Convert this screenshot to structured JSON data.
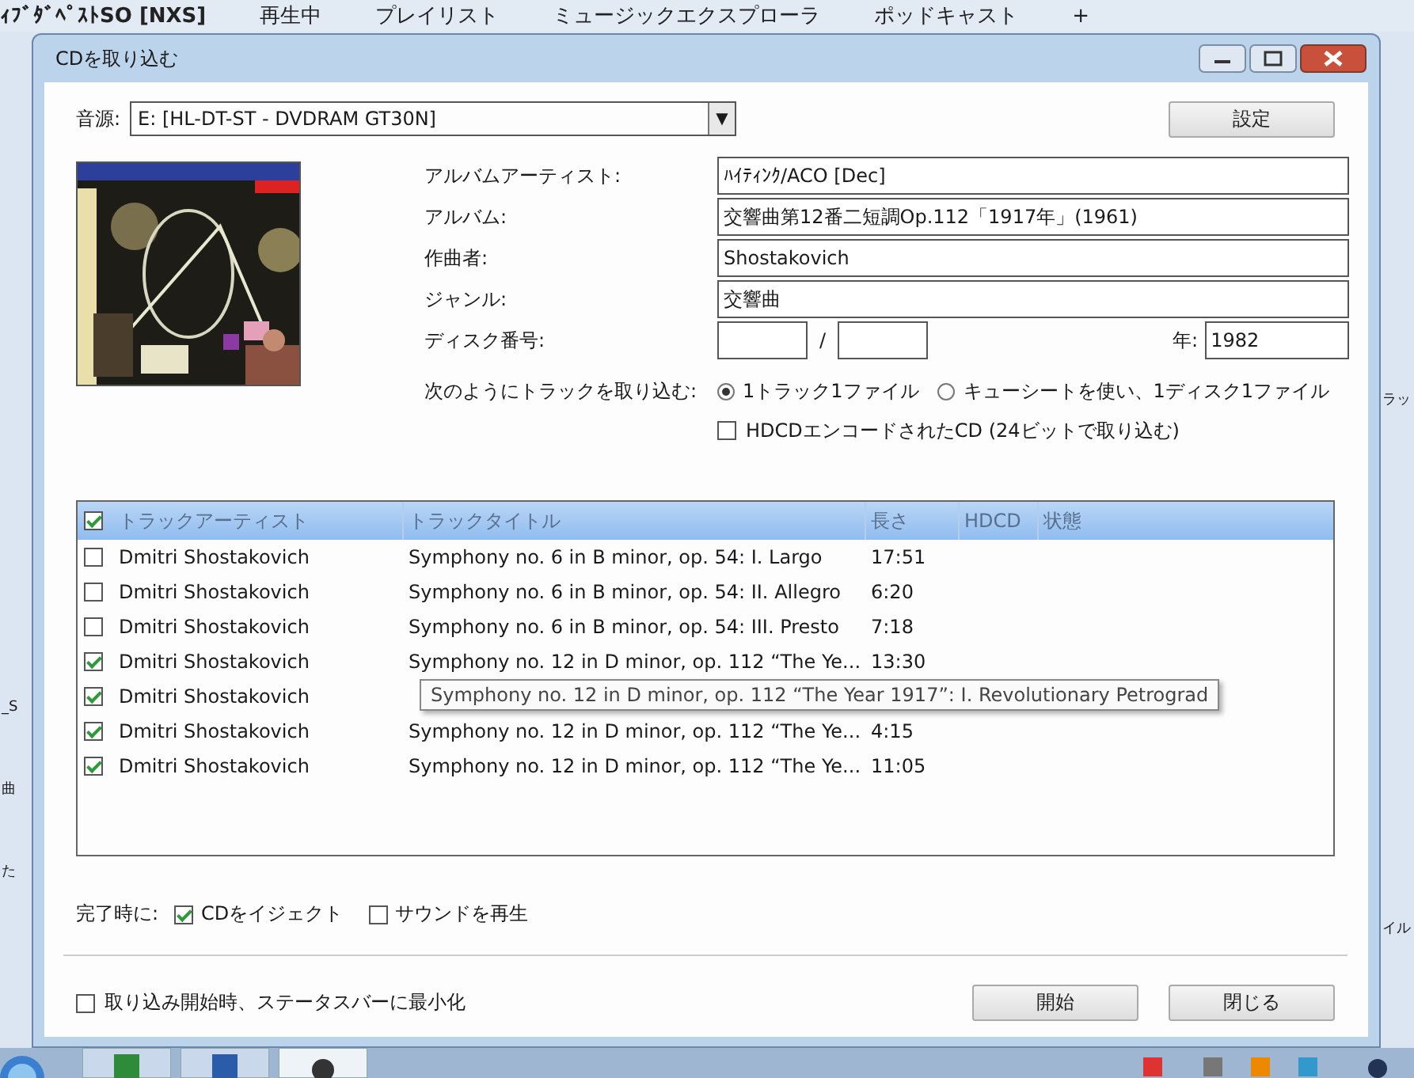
{
  "app_tabs": [
    {
      "label": "ｨﾌﾞﾀﾞﾍﾟｽﾄSO [NXS]",
      "selected": true
    },
    {
      "label": "再生中",
      "selected": false
    },
    {
      "label": "プレイリスト",
      "selected": false
    },
    {
      "label": "ミュージックエクスプローラ",
      "selected": false
    },
    {
      "label": "ポッドキャスト",
      "selected": false
    },
    {
      "label": "+",
      "selected": false
    }
  ],
  "left_fragments": [
    "_S",
    "曲",
    "た"
  ],
  "right_fragments": [
    "ラッ",
    "イル"
  ],
  "dialog": {
    "title": "CDを取り込む",
    "source": {
      "label": "音源:",
      "value": "E: [HL-DT-ST - DVDRAM GT30N]",
      "arrow": "▼"
    },
    "settings_button": "設定",
    "cover": {
      "kind": "picture"
    },
    "fields": [
      {
        "label": "アルバムアーティスト:",
        "value": "ﾊｲﾃｨﾝｸ/ACO [Dec]"
      },
      {
        "label": "アルバム:",
        "value": "交響曲第12番二短調Op.112「1917年」(1961)"
      },
      {
        "label": "作曲者:",
        "value": "Shostakovich"
      },
      {
        "label": "ジャンル:",
        "value": "交響曲"
      }
    ],
    "disc": {
      "label": "ディスク番号:",
      "separator": "/",
      "year_label": "年:",
      "year": "1982"
    },
    "rip_mode": {
      "label": "次のようにトラックを取り込む:",
      "options": [
        {
          "label": "1トラック1ファイル",
          "selected": true
        },
        {
          "label": "キューシートを使い、1ディスク1ファイル",
          "selected": false
        }
      ]
    },
    "hdcd": {
      "label": "HDCDエンコードされたCD (24ビットで取り込む)",
      "checked": false
    },
    "table": {
      "header_checked": true,
      "columns": [
        "トラックアーティスト",
        "トラックタイトル",
        "長さ",
        "HDCD",
        "状態"
      ],
      "rows": [
        {
          "checked": false,
          "artist": "Dmitri Shostakovich",
          "title": "Symphony no. 6 in B minor, op. 54: I. Largo",
          "length": "17:51"
        },
        {
          "checked": false,
          "artist": "Dmitri Shostakovich",
          "title": "Symphony no. 6 in B minor, op. 54: II. Allegro",
          "length": "6:20"
        },
        {
          "checked": false,
          "artist": "Dmitri Shostakovich",
          "title": "Symphony no. 6 in B minor, op. 54: III. Presto",
          "length": "7:18"
        },
        {
          "checked": true,
          "artist": "Dmitri Shostakovich",
          "title": "Symphony no. 12 in D minor, op. 112 “The Ye...",
          "length": "13:30"
        },
        {
          "checked": true,
          "artist": "Dmitri Shostakovich"
        },
        {
          "checked": true,
          "artist": "Dmitri Shostakovich",
          "title": "Symphony no. 12 in D minor, op. 112 “The Ye...",
          "length": "4:15"
        },
        {
          "checked": true,
          "artist": "Dmitri Shostakovich",
          "title": "Symphony no. 12 in D minor, op. 112 “The Ye...",
          "length": "11:05"
        }
      ]
    },
    "tooltip": "Symphony no. 12 in D minor, op. 112 “The Year 1917”: I. Revolutionary Petrograd",
    "on_complete": {
      "label": "完了時に:",
      "options": [
        {
          "label": "CDをイジェクト",
          "checked": true
        },
        {
          "label": "サウンドを再生",
          "checked": false
        }
      ]
    },
    "minimize": {
      "label": "取り込み開始時、ステータスバーに最小化",
      "checked": false
    },
    "buttons": [
      "開始",
      "閉じる"
    ]
  }
}
